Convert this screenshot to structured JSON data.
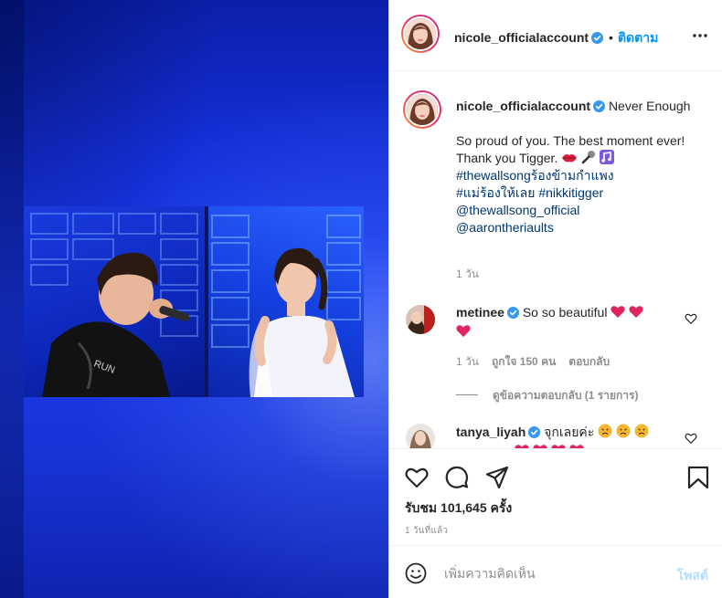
{
  "post": {
    "username": "nicole_officialaccount",
    "follow_label": "ติดตาม",
    "dot": "•"
  },
  "caption": {
    "username": "nicole_officialaccount",
    "title": "Never Enough",
    "body": "So proud of you. The best moment ever! Thank you Tigger.",
    "hashtags": [
      "#thewallsongร้องข้ามกำแพง",
      "#แม่ร้องให้เลย",
      "#nikkitigger"
    ],
    "mentions": [
      "@thewallsong_official",
      "@aarontheriaults"
    ],
    "time": "1 วัน"
  },
  "comments": [
    {
      "username": "metinee",
      "text": "So so beautiful",
      "time": "1 วัน",
      "likes": "ถูกใจ 150 คน",
      "reply": "ตอบกลับ",
      "view_replies": "ดูข้อความตอบกลับ (1 รายการ)"
    },
    {
      "username": "tanya_liyah",
      "text": "จุกเลยค่ะ"
    }
  ],
  "stats": {
    "views": "รับชม 101,645 ครั้ง",
    "age": "1 วันที่แล้ว"
  },
  "add_comment": {
    "placeholder": "เพิ่มความคิดเห็น",
    "post_label": "โพสต์"
  },
  "colors": {
    "link": "#00376b",
    "follow": "#0095f6",
    "muted": "#8e8e8e",
    "heart": "#e0245e"
  }
}
